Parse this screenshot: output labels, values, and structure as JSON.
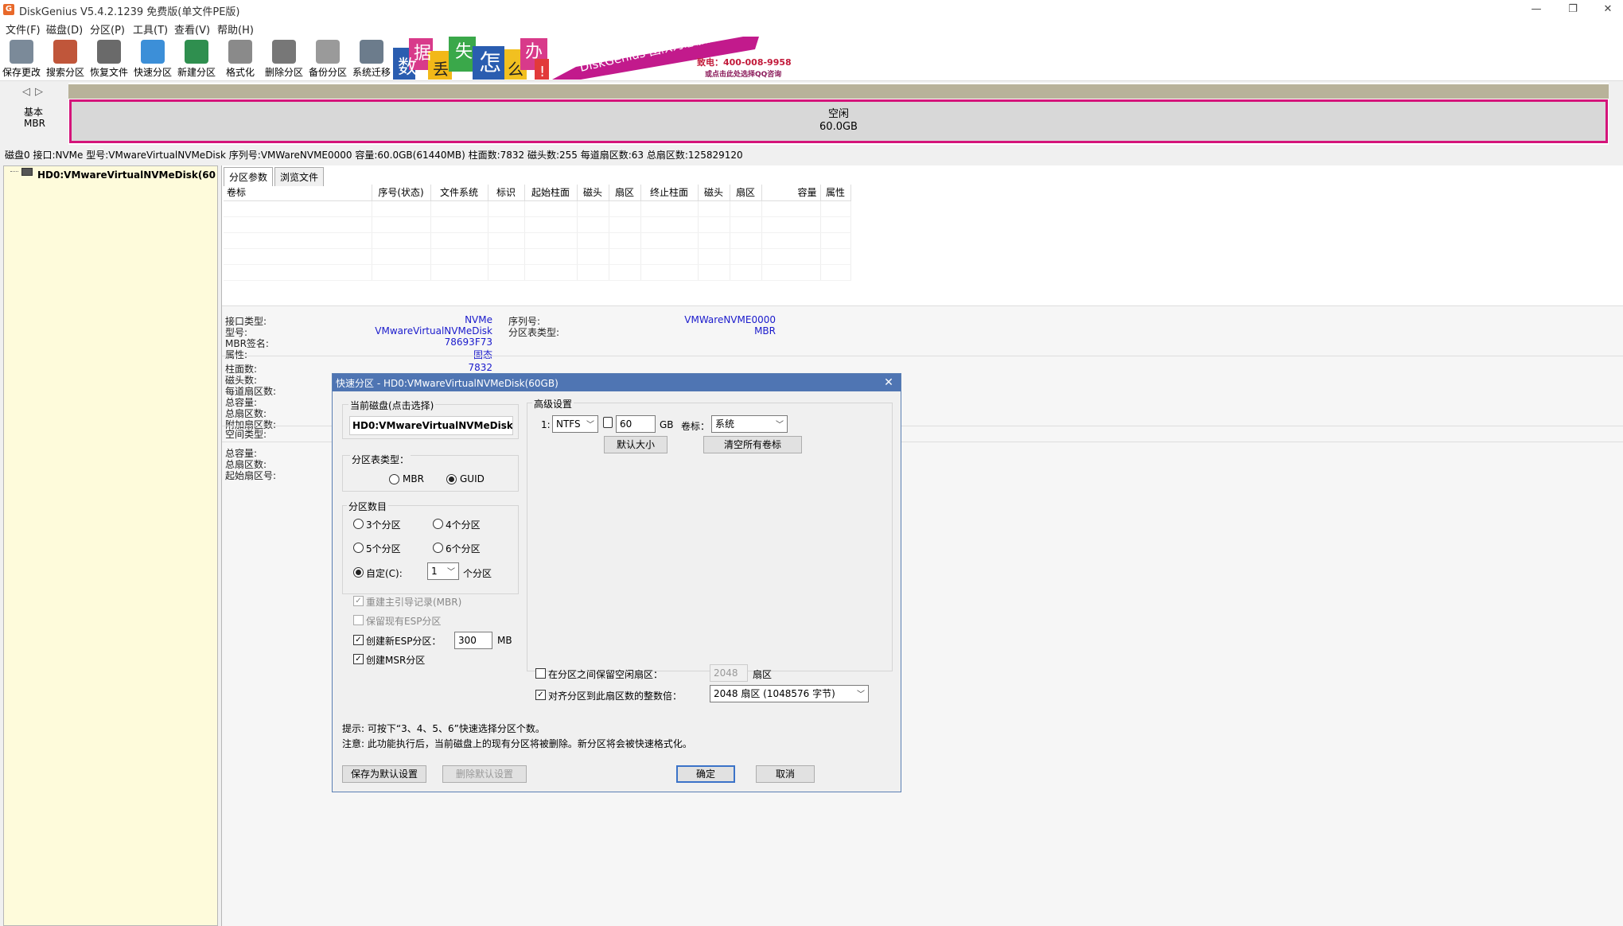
{
  "window": {
    "title": "DiskGenius V5.4.2.1239 免费版(单文件PE版)",
    "minimize": "—",
    "restore": "❐",
    "close": "✕"
  },
  "menu": [
    "文件(F)",
    "磁盘(D)",
    "分区(P)",
    "工具(T)",
    "查看(V)",
    "帮助(H)"
  ],
  "toolbar": [
    {
      "label": "保存更改",
      "icon": "save-icon",
      "color": "#7b8a99"
    },
    {
      "label": "搜索分区",
      "icon": "search-icon",
      "color": "#c0563a"
    },
    {
      "label": "恢复文件",
      "icon": "recover-icon",
      "color": "#6a6a6a"
    },
    {
      "label": "快速分区",
      "icon": "quick-partition-icon",
      "color": "#3c8fd8"
    },
    {
      "label": "新建分区",
      "icon": "new-partition-icon",
      "color": "#2f8f4f"
    },
    {
      "label": "格式化",
      "icon": "format-icon",
      "color": "#8a8a8a"
    },
    {
      "label": "删除分区",
      "icon": "delete-icon",
      "color": "#777777"
    },
    {
      "label": "备份分区",
      "icon": "backup-icon",
      "color": "#9a9a9a"
    },
    {
      "label": "系统迁移",
      "icon": "migrate-icon",
      "color": "#6c7c8c"
    }
  ],
  "banner": {
    "tiles": [
      "数",
      "据",
      "丢",
      "失",
      "怎",
      "么",
      "办",
      "!"
    ],
    "slogan": "DiskGenius 团队为您服务",
    "phone": "致电：400-008-9958",
    "qq": "或点击此处选择QQ咨询"
  },
  "diskmap": {
    "nav_left": "◁",
    "nav_right": "▷",
    "type1": "基本",
    "type2": "MBR",
    "free_label": "空闲",
    "free_size": "60.0GB"
  },
  "diskinfo": "磁盘0 接口:NVMe  型号:VMwareVirtualNVMeDisk  序列号:VMWareNVME0000  容量:60.0GB(61440MB)  柱面数:7832  磁头数:255  每道扇区数:63  总扇区数:125829120",
  "tree": {
    "item": "HD0:VMwareVirtualNVMeDisk(60"
  },
  "tabs": [
    "分区参数",
    "浏览文件"
  ],
  "table_headers": [
    "卷标",
    "序号(状态)",
    "文件系统",
    "标识",
    "起始柱面",
    "磁头",
    "扇区",
    "终止柱面",
    "磁头",
    "扇区",
    "容量",
    "属性"
  ],
  "details": {
    "left": [
      {
        "k": "接口类型:",
        "v": "NVMe"
      },
      {
        "k": "型号:",
        "v": "VMwareVirtualNVMeDisk"
      },
      {
        "k": "MBR签名:",
        "v": "78693F73"
      },
      {
        "k": "属性:",
        "v": "固态"
      }
    ],
    "right": [
      {
        "k": "序列号:",
        "v": "VMWareNVME0000"
      },
      {
        "k": "分区表类型:",
        "v": "MBR"
      }
    ],
    "geo": [
      {
        "k": "柱面数:",
        "v": "7832"
      },
      {
        "k": "磁头数:",
        "v": ""
      },
      {
        "k": "每道扇区数:",
        "v": ""
      },
      {
        "k": "总容量:",
        "v": ""
      },
      {
        "k": "总扇区数:",
        "v": ""
      },
      {
        "k": "附加扇区数:",
        "v": ""
      }
    ],
    "space": [
      {
        "k": "空间类型:",
        "v": ""
      }
    ],
    "totals": [
      {
        "k": "总容量:",
        "v": ""
      },
      {
        "k": "总扇区数:",
        "v": ""
      },
      {
        "k": "起始扇区号:",
        "v": ""
      }
    ]
  },
  "dialog": {
    "title": "快速分区 - HD0:VMwareVirtualNVMeDisk(60GB)",
    "close": "✕",
    "current_disk_label": "当前磁盘(点击选择)",
    "current_disk": "HD0:VMwareVirtualNVMeDisk",
    "pt_type_label": "分区表类型：",
    "mbr": "MBR",
    "guid": "GUID",
    "count_label": "分区数目",
    "c3": "3个分区",
    "c4": "4个分区",
    "c5": "5个分区",
    "c6": "6个分区",
    "custom": "自定(C):",
    "custom_value": "1",
    "custom_suffix": "个分区",
    "rebuild_mbr": "重建主引导记录(MBR)",
    "keep_esp": "保留现有ESP分区",
    "new_esp": "创建新ESP分区：",
    "esp_size": "300",
    "esp_unit": "MB",
    "msr": "创建MSR分区",
    "adv_label": "高级设置",
    "row_index": "1:",
    "fs": "NTFS",
    "size": "60",
    "size_unit": "GB",
    "vol_label": "卷标：",
    "vol_value": "系统",
    "default_size_btn": "默认大小",
    "clear_labels_btn": "清空所有卷标",
    "reserve_label": "在分区之间保留空闲扇区：",
    "reserve_value": "2048",
    "reserve_unit": "扇区",
    "align_label": "对齐分区到此扇区数的整数倍：",
    "align_value": "2048 扇区 (1048576 字节)",
    "tip1": "提示: 可按下“3、4、5、6”快速选择分区个数。",
    "tip2": "注意: 此功能执行后，当前磁盘上的现有分区将被删除。新分区将会被快速格式化。",
    "save_default_btn": "保存为默认设置",
    "delete_default_btn": "删除默认设置",
    "ok_btn": "确定",
    "cancel_btn": "取消"
  }
}
